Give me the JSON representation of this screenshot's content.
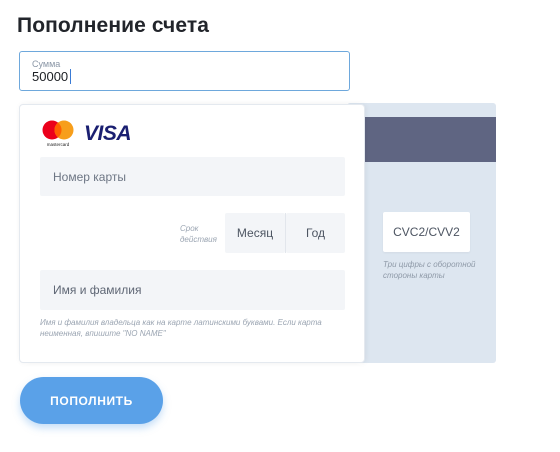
{
  "page": {
    "title": "Пополнение счета"
  },
  "amount": {
    "label": "Сумма",
    "value": "50000"
  },
  "card_front": {
    "logos": {
      "mastercard_text": "mastercard",
      "visa_text": "VISA"
    },
    "card_number_placeholder": "Номер карты",
    "expiry_label": "Срок действия",
    "month_placeholder": "Месяц",
    "year_placeholder": "Год",
    "holder_placeholder": "Имя и фамилия",
    "holder_hint": "Имя и фамилия владельца как на карте латинскими буквами. Если карта неименная, впишите \"NO NAME\""
  },
  "card_back": {
    "cvc_placeholder": "CVC2/CVV2",
    "cvc_hint": "Три цифры с оборотной стороны карты"
  },
  "submit": {
    "label": "ПОПОЛНИТЬ"
  },
  "colors": {
    "accent": "#5aa1e8",
    "stripe": "#5f6582",
    "back_card": "#dde6f0",
    "visa": "#1a1f71"
  }
}
